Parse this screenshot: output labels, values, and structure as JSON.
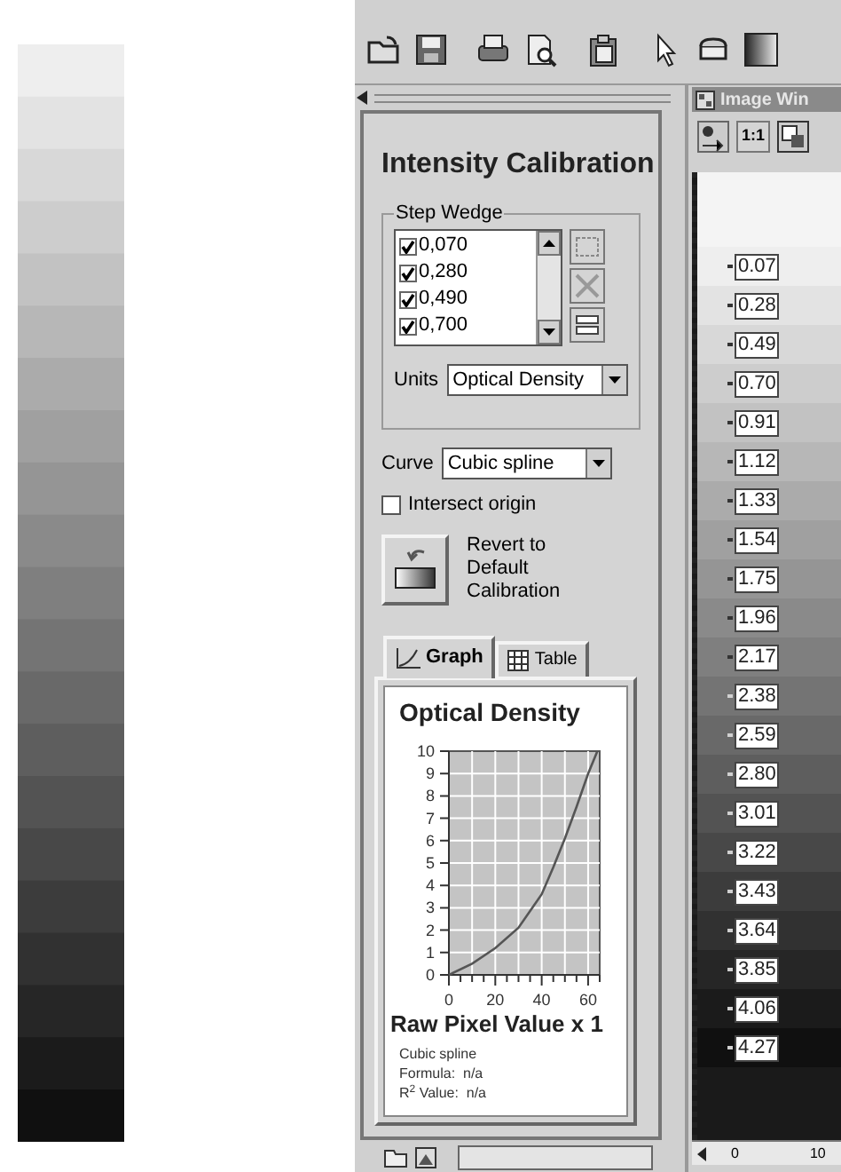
{
  "panel": {
    "title": "Intensity Calibration",
    "step_wedge": {
      "label": "Step Wedge",
      "items": [
        {
          "value": "0,070",
          "checked": true
        },
        {
          "value": "0,280",
          "checked": true
        },
        {
          "value": "0,490",
          "checked": true
        },
        {
          "value": "0,700",
          "checked": true
        }
      ]
    },
    "units": {
      "label": "Units",
      "value": "Optical Density"
    },
    "curve": {
      "label": "Curve",
      "value": "Cubic spline"
    },
    "intersect_origin": {
      "label": "Intersect origin",
      "checked": false
    },
    "revert_button": {
      "label": "Revert to Default Calibration"
    },
    "tabs": [
      {
        "label": "Graph",
        "selected": true
      },
      {
        "label": "Table",
        "selected": false
      }
    ],
    "graph": {
      "chart_data": {
        "type": "line",
        "title": "Optical Density",
        "xlabel": "Raw Pixel Value x 1",
        "x": [
          0,
          10,
          20,
          30,
          40,
          45,
          50,
          55,
          60,
          64
        ],
        "series": [
          {
            "name": "Cubic spline",
            "color": "#555555",
            "values": [
              0,
              0.5,
              1.2,
              2.1,
              3.6,
              4.8,
              6.1,
              7.5,
              9,
              10
            ]
          }
        ],
        "grid": true,
        "xlim": [
          0,
          65
        ],
        "ylim": [
          0,
          10
        ],
        "xticks": [
          0,
          20,
          40,
          60
        ],
        "yticks": [
          0,
          1,
          2,
          3,
          4,
          5,
          6,
          7,
          8,
          9,
          10
        ]
      },
      "notes": [
        "Formula:  n/a",
        "R$^{2}$ Value:  n/a"
      ]
    }
  },
  "image_window": {
    "title": "Image Win",
    "zoom_button": "1:1",
    "step_labels": [
      "0.07",
      "0.28",
      "0.49",
      "0.70",
      "0.91",
      "1.12",
      "1.33",
      "1.54",
      "1.75",
      "1.96",
      "2.17",
      "2.38",
      "2.59",
      "2.80",
      "3.01",
      "3.22",
      "3.43",
      "3.64",
      "3.85",
      "4.06",
      "4.27"
    ],
    "ruler": [
      "0",
      "10"
    ]
  }
}
